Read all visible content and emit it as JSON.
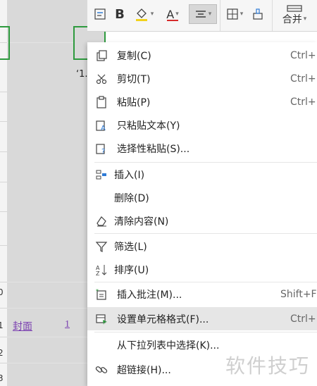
{
  "sheet": {
    "row_numbers": [
      "0",
      "1",
      "2",
      "3"
    ],
    "link_text": "封面",
    "link_number": "1",
    "cell_fragment": "‘1."
  },
  "toolbar": {
    "bold": "B",
    "font_color": "A",
    "merge_label": "合并"
  },
  "menu": {
    "items": [
      {
        "label": "复制(C)",
        "shortcut": "Ctrl+",
        "icon": "copy-icon"
      },
      {
        "label": "剪切(T)",
        "shortcut": "Ctrl+",
        "icon": "scissors-icon"
      },
      {
        "label": "粘贴(P)",
        "shortcut": "Ctrl+",
        "icon": "paste-icon"
      },
      {
        "label": "只粘贴文本(Y)",
        "shortcut": "",
        "icon": "paste-text-icon"
      },
      {
        "label": "选择性粘贴(S)...",
        "shortcut": "",
        "icon": "paste-special-icon"
      },
      {
        "label": "插入(I)",
        "shortcut": "",
        "icon": "insert-icon"
      },
      {
        "label": "删除(D)",
        "shortcut": "",
        "icon": ""
      },
      {
        "label": "清除内容(N)",
        "shortcut": "",
        "icon": "eraser-icon"
      },
      {
        "label": "筛选(L)",
        "shortcut": "",
        "icon": "filter-icon"
      },
      {
        "label": "排序(U)",
        "shortcut": "",
        "icon": "sort-icon"
      },
      {
        "label": "插入批注(M)...",
        "shortcut": "Shift+F",
        "icon": "comment-icon"
      },
      {
        "label": "设置单元格格式(F)...",
        "shortcut": "Ctrl+",
        "icon": "format-cells-icon"
      },
      {
        "label": "从下拉列表中选择(K)...",
        "shortcut": "",
        "icon": ""
      },
      {
        "label": "超链接(H)...",
        "shortcut": "",
        "icon": "link-icon"
      }
    ]
  },
  "watermark": "软件技巧",
  "colors": {
    "accent_green": "#2e9a3e",
    "font_red": "#d62b2b",
    "highlight_yellow": "#f2d21b",
    "link_purple": "#7a3fb0"
  }
}
